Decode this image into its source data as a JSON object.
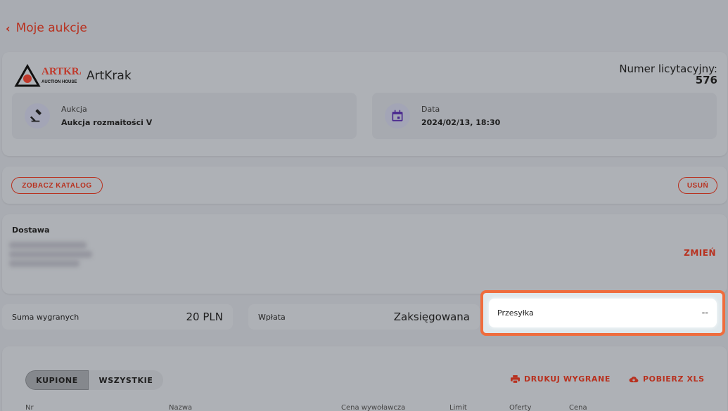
{
  "nav": {
    "back_label": "Moje aukcje"
  },
  "header": {
    "logo_text": "ARTKRAK",
    "logo_subtext": "AUCTION HOUSE",
    "house_name": "ArtKrak",
    "bid_number_label": "Numer licytacyjny:",
    "bid_number": "576"
  },
  "auction": {
    "label": "Aukcja",
    "value": "Aukcja rozmaitości V"
  },
  "date": {
    "label": "Data",
    "value": "2024/02/13, 18:30"
  },
  "actions": {
    "catalog_label": "ZOBACZ KATALOG",
    "delete_label": "USUŃ"
  },
  "delivery": {
    "title": "Dostawa",
    "change_label": "ZMIEŃ"
  },
  "summary": {
    "wins_label": "Suma wygranych",
    "wins_value": "20 PLN",
    "payment_label": "Wpłata",
    "payment_value": "Zaksięgowana",
    "shipping_label": "Przesyłka",
    "shipping_value": "--"
  },
  "tabs": {
    "bought_label": "KUPIONE",
    "all_label": "WSZYSTKIE"
  },
  "links": {
    "print_label": "DRUKUJ WYGRANE",
    "xls_label": "POBIERZ XLS"
  },
  "table": {
    "columns": [
      "Nr",
      "Nazwa",
      "Cena wywoławcza",
      "Limit",
      "Oferty",
      "Cena"
    ]
  },
  "colors": {
    "accent": "#b8311f",
    "highlight": "#ef6d3e",
    "background": "#a9acb2"
  }
}
